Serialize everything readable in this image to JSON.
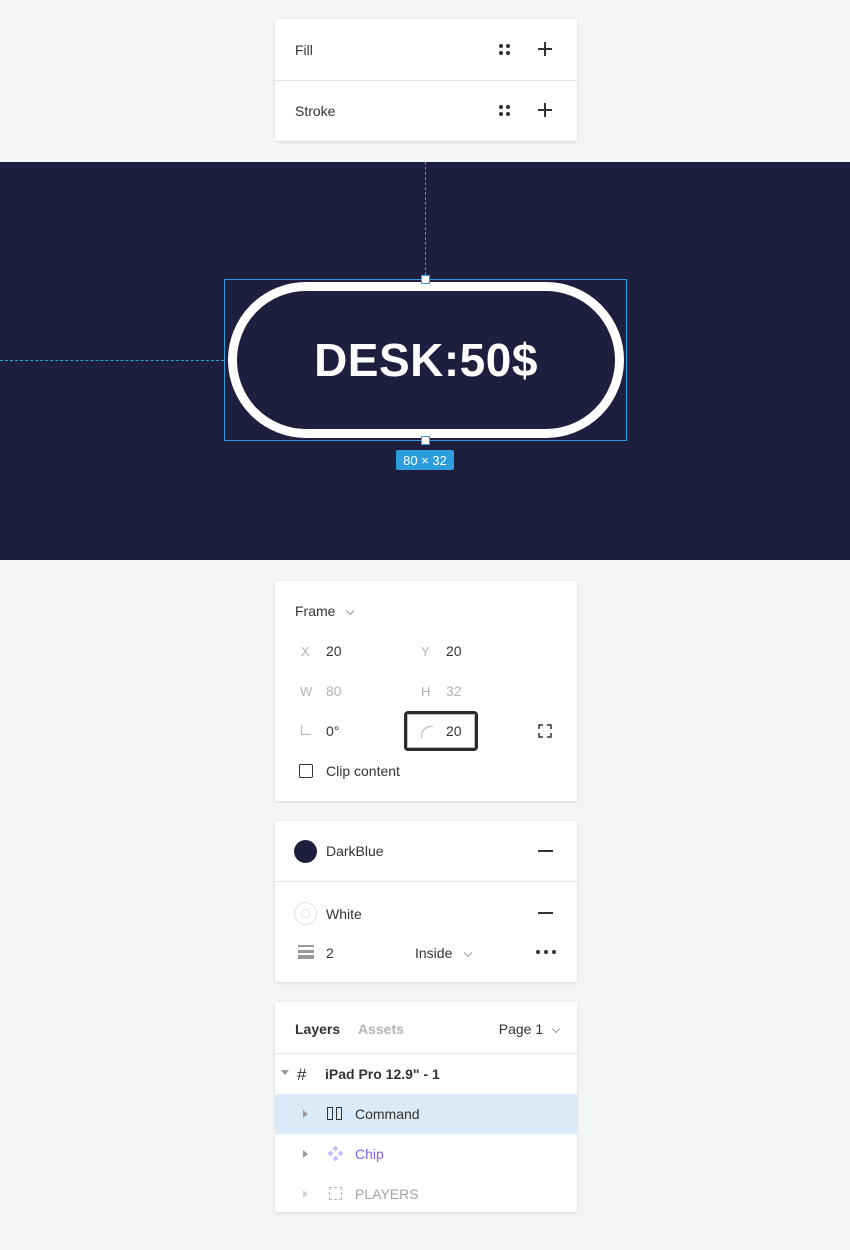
{
  "fill_stroke_panel": {
    "fill_label": "Fill",
    "stroke_label": "Stroke"
  },
  "canvas": {
    "chip_text": "DESK:50$",
    "size_label": "80 × 32",
    "background_color": "#1e1f3f",
    "selection_color": "#2d9cdb"
  },
  "frame_panel": {
    "title": "Frame",
    "x_label": "X",
    "x_value": "20",
    "y_label": "Y",
    "y_value": "20",
    "w_label": "W",
    "w_value": "80",
    "h_label": "H",
    "h_value": "32",
    "rotation_value": "0°",
    "radius_value": "20",
    "clip_content_label": "Clip content"
  },
  "style_panel": {
    "fill_name": "DarkBlue",
    "fill_color": "#1e1f3f",
    "stroke_name": "White",
    "stroke_color": "#ffffff",
    "stroke_weight": "2",
    "stroke_position": "Inside"
  },
  "layers_panel": {
    "tab_layers": "Layers",
    "tab_assets": "Assets",
    "page": "Page 1",
    "root": "iPad Pro 12.9\" - 1",
    "items": [
      {
        "name": "Command"
      },
      {
        "name": "Chip"
      },
      {
        "name": "PLAYERS"
      }
    ]
  }
}
